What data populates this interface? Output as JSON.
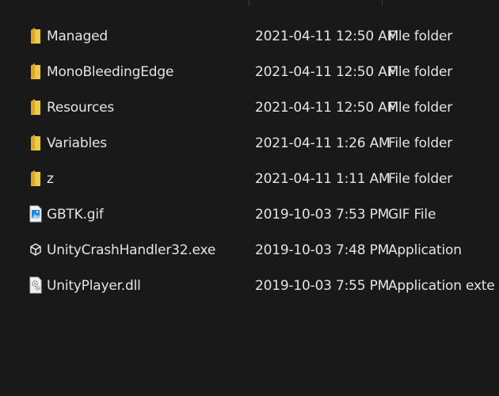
{
  "files": [
    {
      "icon": "folder-icon",
      "name": "Managed",
      "date": "2021-04-11 12:50 AM",
      "type": "File folder"
    },
    {
      "icon": "folder-icon",
      "name": "MonoBleedingEdge",
      "date": "2021-04-11 12:50 AM",
      "type": "File folder"
    },
    {
      "icon": "folder-icon",
      "name": "Resources",
      "date": "2021-04-11 12:50 AM",
      "type": "File folder"
    },
    {
      "icon": "folder-icon",
      "name": "Variables",
      "date": "2021-04-11 1:26 AM",
      "type": "File folder"
    },
    {
      "icon": "folder-icon",
      "name": "z",
      "date": "2021-04-11 1:11 AM",
      "type": "File folder"
    },
    {
      "icon": "gif-image-icon",
      "name": "GBTK.gif",
      "date": "2019-10-03 7:53 PM",
      "type": "GIF File"
    },
    {
      "icon": "unity-application-icon",
      "name": "UnityCrashHandler32.exe",
      "date": "2019-10-03 7:48 PM",
      "type": "Application"
    },
    {
      "icon": "dll-gear-icon",
      "name": "UnityPlayer.dll",
      "date": "2019-10-03 7:55 PM",
      "type": "Application extens..."
    }
  ],
  "colors": {
    "background": "#191919",
    "text": "#e4e4e4",
    "folder": "#f0c64b"
  }
}
